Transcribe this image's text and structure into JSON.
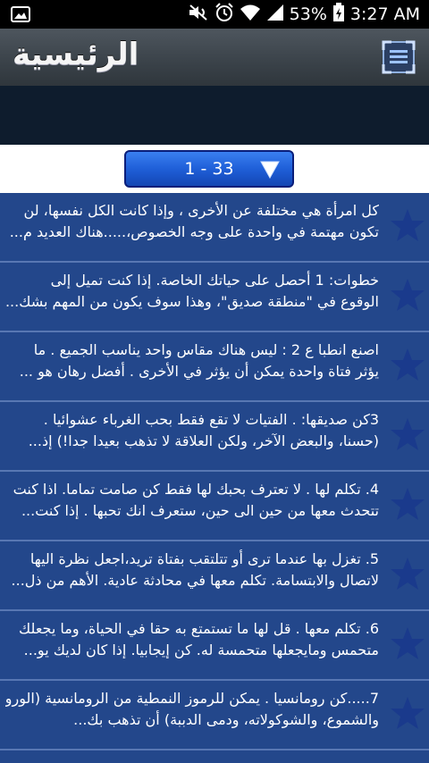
{
  "status_bar": {
    "battery": "53%",
    "time": "3:27 AM",
    "icons": [
      "gallery-icon",
      "mute-icon",
      "alarm-icon",
      "wifi-icon",
      "signal-icon",
      "battery-charging-icon"
    ]
  },
  "header": {
    "title": "الرئيسية",
    "menu_icon": "expand-menu-icon"
  },
  "pager": {
    "range": "1 - 33",
    "arrow_icon": "triangle-down-icon"
  },
  "items": [
    {
      "line1": "كل امرأة هي مختلفة عن الأخرى ، وإذا كانت الكل نفسها، لن",
      "line2": "تكون مهتمة في واحدة على وجه الخصوص،.....هناك العديد م..."
    },
    {
      "line1": "خطوات: 1 أحصل على حياتك الخاصة. إذا كنت تميل إلى",
      "line2": "الوقوع في \"منطقة صديق\"، وهذا سوف يكون من المهم بشك..."
    },
    {
      "line1": "اصنع انطبا ع 2 : ليس هناك مقاس واحد يناسب الجميع . ما",
      "line2": "يؤثر فتاة واحدة يمكن أن يؤثر في الأخرى . أفضل رهان هو ..."
    },
    {
      "line1": "3كن صديقها: . الفتيات لا تقع فقط بحب الغرباء عشوائيا .",
      "line2": "(حسنا، والبعض الآخر، ولكن العلاقة لا تذهب بعيدا جدا!) إذ..."
    },
    {
      "line1": "4. تكلم لها . لا تعترف بحبك لها فقط كن صامت تماما. اذا كنت",
      "line2": "تتحدث معها من حين الى حين، ستعرف انك تحبها . إذا كنت..."
    },
    {
      "line1": "5. تغزل بها عندما ترى أو تتلتقب بفتاة تريد،اجعل نظرة اليها",
      "line2": "لاتصال والابتسامة. تكلم معها في محادثة عادية. الأهم من ذل..."
    },
    {
      "line1": "6. تكلم معها . قل لها ما تستمتع به حقا في الحياة، وما يجعلك",
      "line2": "متحمس ومايجعلها متحمسة له. كن إيجابيا. إذا كان لديك يو..."
    },
    {
      "line1": "7.....كن رومانسيا . يمكن للرموز النمطية من الرومانسية (الورود",
      "line2": "والشموع، والشوكولاته، ودمى الدببة) أن تذهب بك..."
    }
  ],
  "star_icon": "star-icon",
  "colors": {
    "list_bg": "#23478b",
    "divider": "#5877b3",
    "star": "#1a3a8c",
    "selector": "#1f5fd8"
  }
}
